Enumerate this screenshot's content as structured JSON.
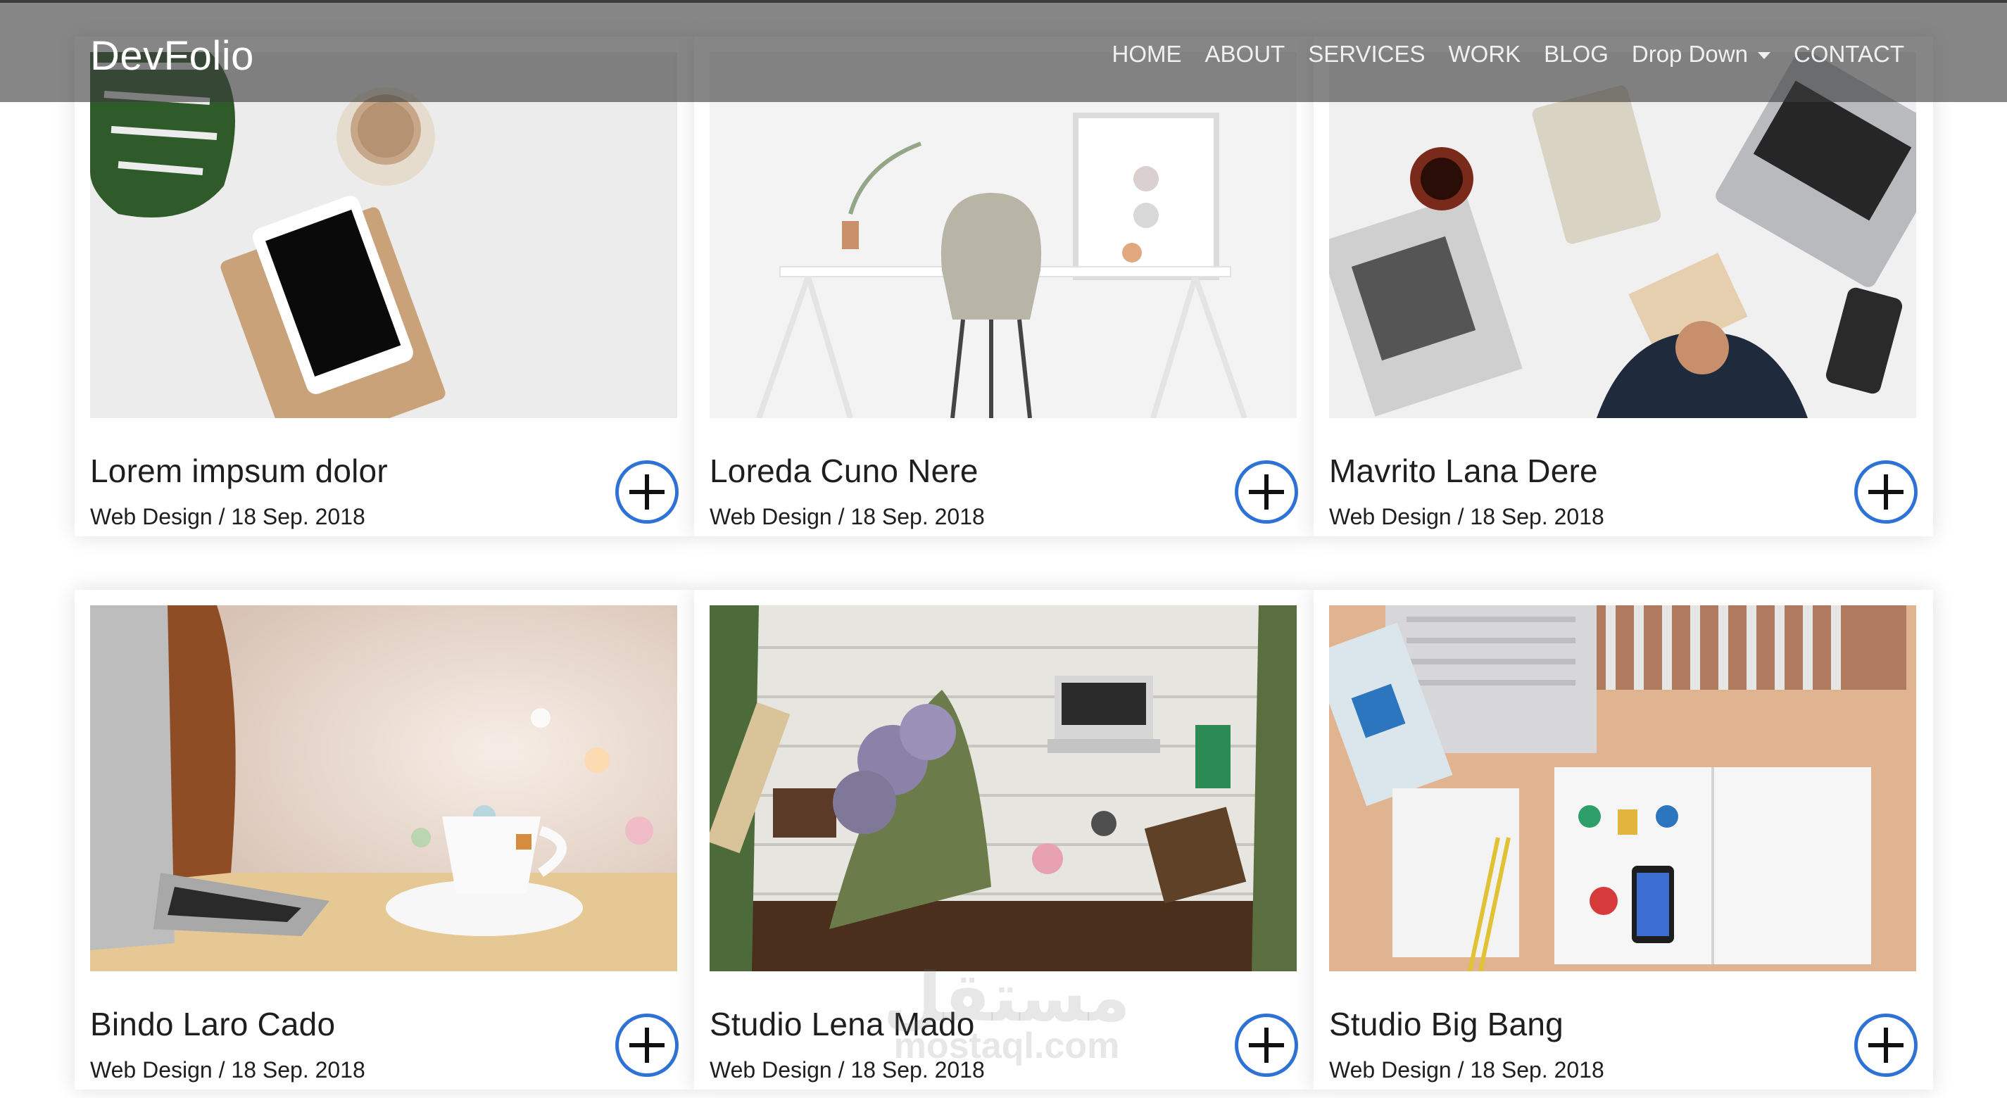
{
  "navbar": {
    "brand": "DevFolio",
    "links": [
      "HOME",
      "ABOUT",
      "SERVICES",
      "WORK",
      "BLOG",
      "Drop Down",
      "CONTACT"
    ]
  },
  "portfolio": {
    "items": [
      {
        "title": "Lorem impsum dolor",
        "meta": "Web Design / 18 Sep. 2018"
      },
      {
        "title": "Loreda Cuno Nere",
        "meta": "Web Design / 18 Sep. 2018"
      },
      {
        "title": "Mavrito Lana Dere",
        "meta": "Web Design / 18 Sep. 2018"
      },
      {
        "title": "Bindo Laro Cado",
        "meta": "Web Design / 18 Sep. 2018"
      },
      {
        "title": "Studio Lena Mado",
        "meta": "Web Design / 18 Sep. 2018"
      },
      {
        "title": "Studio Big Bang",
        "meta": "Web Design / 18 Sep. 2018"
      }
    ]
  },
  "watermark": {
    "arabic": "مستقل",
    "latin": "mostaql.com"
  },
  "colors": {
    "accent": "#2f72d6",
    "navbar": "#3c3c3c"
  }
}
